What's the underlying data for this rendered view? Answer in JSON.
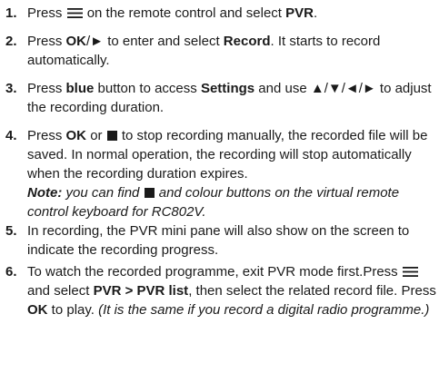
{
  "steps": [
    {
      "number": "1.",
      "t1": "Press",
      "icon": "menu-icon",
      "t2": "on the remote control and select",
      "b1": "PVR",
      "t3": "."
    },
    {
      "number": "2.",
      "t1": "Press",
      "b1": "OK",
      "t2": "/► to enter and select",
      "b2": "Record",
      "t3": ". It starts to record automatically."
    },
    {
      "number": "3.",
      "t1": "Press",
      "b1": "blue",
      "t2": "button to access",
      "b2": "Settings",
      "t3": "and use ▲/▼/◄/► to adjust the recording duration."
    },
    {
      "number": "4.",
      "t1": "Press",
      "b1": "OK",
      "t2": "or",
      "icon": "stop-icon",
      "t3": "to stop recording manually, the recorded file will be saved. In normal operation, the recording will stop automatically when the recording duration expires.",
      "note_label": "Note:",
      "note_t1": "you can find",
      "note_icon": "stop-icon",
      "note_t2": "and colour buttons on the virtual remote control keyboard for RC802V."
    },
    {
      "number": "5.",
      "text": "In recording, the PVR mini pane will also show on the screen to indicate the recording progress."
    },
    {
      "number": "6.",
      "t1": "To watch the recorded programme, exit PVR mode first.Press",
      "icon": "menu-icon",
      "t2": "and select",
      "b1": "PVR > PVR list",
      "t3": ", then select the related record file. Press",
      "b2": "OK",
      "t4": "to play.",
      "italic": "(It is the same if you record a digital radio programme.)"
    }
  ]
}
